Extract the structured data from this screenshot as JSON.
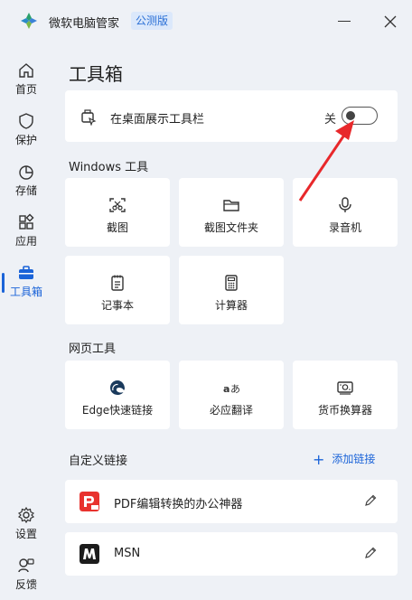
{
  "app": {
    "title": "微软电脑管家",
    "badge": "公测版"
  },
  "sidebar": {
    "items": [
      {
        "label": "首页",
        "icon": "home-icon"
      },
      {
        "label": "保护",
        "icon": "shield-icon"
      },
      {
        "label": "存储",
        "icon": "pie-chart-icon"
      },
      {
        "label": "应用",
        "icon": "apps-icon"
      },
      {
        "label": "工具箱",
        "icon": "toolbox-icon",
        "active": true
      }
    ],
    "bottom": [
      {
        "label": "设置",
        "icon": "gear-icon"
      },
      {
        "label": "反馈",
        "icon": "feedback-icon"
      }
    ]
  },
  "main": {
    "title": "工具箱",
    "desktop_toggle": {
      "label": "在桌面展示工具栏",
      "state": "关",
      "on": false
    },
    "windows_tools": {
      "title": "Windows 工具",
      "tiles": [
        {
          "label": "截图",
          "icon": "screenshot-icon"
        },
        {
          "label": "截图文件夹",
          "icon": "folder-icon"
        },
        {
          "label": "录音机",
          "icon": "microphone-icon"
        },
        {
          "label": "记事本",
          "icon": "notepad-icon"
        },
        {
          "label": "计算器",
          "icon": "calculator-icon"
        }
      ]
    },
    "web_tools": {
      "title": "网页工具",
      "tiles": [
        {
          "label": "Edge快速链接",
          "icon": "edge-icon"
        },
        {
          "label": "必应翻译",
          "icon": "translate-icon"
        },
        {
          "label": "货币换算器",
          "icon": "currency-icon"
        }
      ]
    },
    "custom_links": {
      "title": "自定义链接",
      "add_label": "添加链接",
      "items": [
        {
          "label": "PDF编辑转换的办公神器",
          "icon": "pdf-app-icon"
        },
        {
          "label": "MSN",
          "icon": "msn-icon"
        }
      ]
    }
  },
  "colors": {
    "accent": "#1a63d8",
    "background": "#eef1f6",
    "arrow": "#e8282b"
  }
}
